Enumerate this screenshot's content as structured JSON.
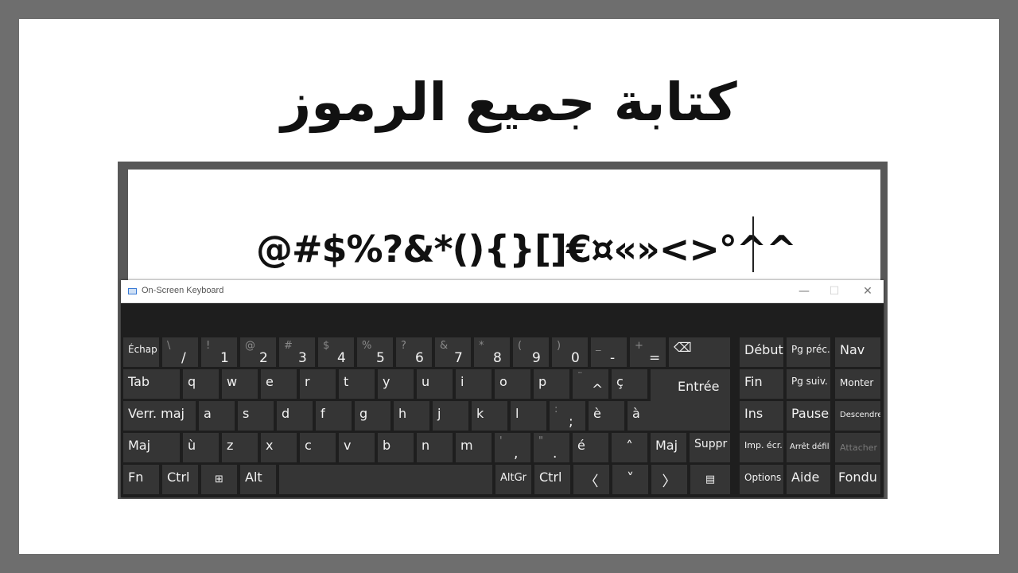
{
  "headline": "كتابة جميع الرموز",
  "document": {
    "typed_text": "@#$%?&*(){}[]€¤«»<>°^^"
  },
  "osk": {
    "title": "On-Screen Keyboard",
    "window_buttons": {
      "minimize": "—",
      "maximize": "☐",
      "close": "✕"
    },
    "keys": {
      "esc": "Échap",
      "k1_shift": "\\",
      "k1": "/",
      "k2_shift": "!",
      "k2": "1",
      "k3_shift": "@",
      "k3": "2",
      "k4_shift": "#",
      "k4": "3",
      "k5_shift": "$",
      "k5": "4",
      "k6_shift": "%",
      "k6": "5",
      "k7_shift": "?",
      "k7": "6",
      "k8_shift": "&",
      "k8": "7",
      "k9_shift": "*",
      "k9": "8",
      "k10_shift": "(",
      "k10": "9",
      "k11_shift": ")",
      "k11": "0",
      "k12_shift": "_",
      "k12": "-",
      "k13_shift": "+",
      "k13": "=",
      "backspace": "⌫",
      "home": "Début",
      "pgup": "Pg préc.",
      "nav": "Nav",
      "tab": "Tab",
      "q": "q",
      "w": "w",
      "e": "e",
      "r": "r",
      "t": "t",
      "y": "y",
      "u": "u",
      "i": "i",
      "o": "o",
      "p": "p",
      "hat_shift": "¨",
      "hat": "^",
      "cedil": "ç",
      "enter": "Entrée",
      "end": "Fin",
      "pgdn": "Pg suiv.",
      "up_mv": "Monter",
      "caps": "Verr. maj",
      "a": "a",
      "s": "s",
      "d": "d",
      "f": "f",
      "g": "g",
      "h": "h",
      "j": "j",
      "k": "k",
      "l": "l",
      "semi_shift": ":",
      "semi": ";",
      "egrave": "è",
      "agrave": "à",
      "ins": "Ins",
      "pause": "Pause",
      "down_mv": "Descendre",
      "shift_l": "Maj",
      "ugrave": "ù",
      "z": "z",
      "x": "x",
      "c": "c",
      "v": "v",
      "b": "b",
      "n": "n",
      "m": "m",
      "comma_shift": "'",
      "comma": ",",
      "dot_shift": "\"",
      "dot": ".",
      "eacute": "é",
      "arrow_up": "˄",
      "shift_r": "Maj",
      "del": "Suppr",
      "prtsc": "Imp. écr.",
      "scrlk": "Arrêt défil",
      "dock": "Attacher",
      "fn": "Fn",
      "ctrl_l": "Ctrl",
      "win": "⊞",
      "alt": "Alt",
      "altgr": "AltGr",
      "ctrl_r": "Ctrl",
      "arrow_left": "〈",
      "arrow_down": "˅",
      "arrow_right": "〉",
      "menu": "▤",
      "options": "Options",
      "help": "Aide",
      "fade": "Fondu"
    }
  }
}
